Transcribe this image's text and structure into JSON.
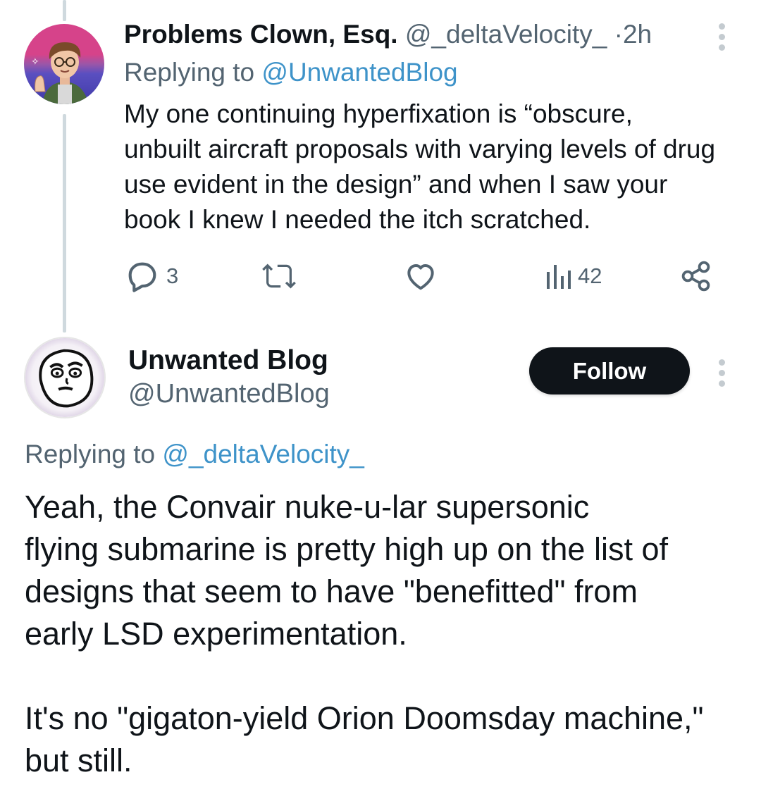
{
  "reply_tweet": {
    "author_name": "Problems Clown, Esq.",
    "author_handle": "@_deltaVelocity_",
    "separator": "·",
    "time": "2h",
    "replying_prefix": "Replying to",
    "replying_handle": "@UnwantedBlog",
    "text_lines": [
      "My one continuing hyperfixation is “obscure,",
      "unbuilt aircraft proposals with varying levels of drug",
      "use evident in the design” and when I saw your",
      "book I knew I needed the itch scratched."
    ],
    "actions": {
      "replies": "3",
      "retweets": "",
      "likes": "",
      "views": "42"
    },
    "icons": [
      "reply-icon",
      "retweet-icon",
      "like-icon",
      "views-icon",
      "share-icon",
      "more-icon"
    ]
  },
  "main_tweet": {
    "author_name": "Unwanted Blog",
    "author_handle": "@UnwantedBlog",
    "follow_label": "Follow",
    "replying_prefix": "Replying to",
    "replying_handle": "@_deltaVelocity_",
    "paragraph_1": [
      "Yeah, the Convair nuke-u-lar supersonic",
      "flying submarine is pretty high up on the list of",
      "designs that seem to have \"benefitted\" from",
      "early LSD experimentation."
    ],
    "paragraph_2": [
      "It's no \"gigaton-yield Orion Doomsday machine,\"",
      "but still."
    ]
  },
  "colors": {
    "text": "#0f1419",
    "muted": "#536471",
    "link": "#3e93c9",
    "thread_line": "#cfd9de",
    "follow_bg": "#0f1419",
    "follow_text": "#ffffff"
  }
}
